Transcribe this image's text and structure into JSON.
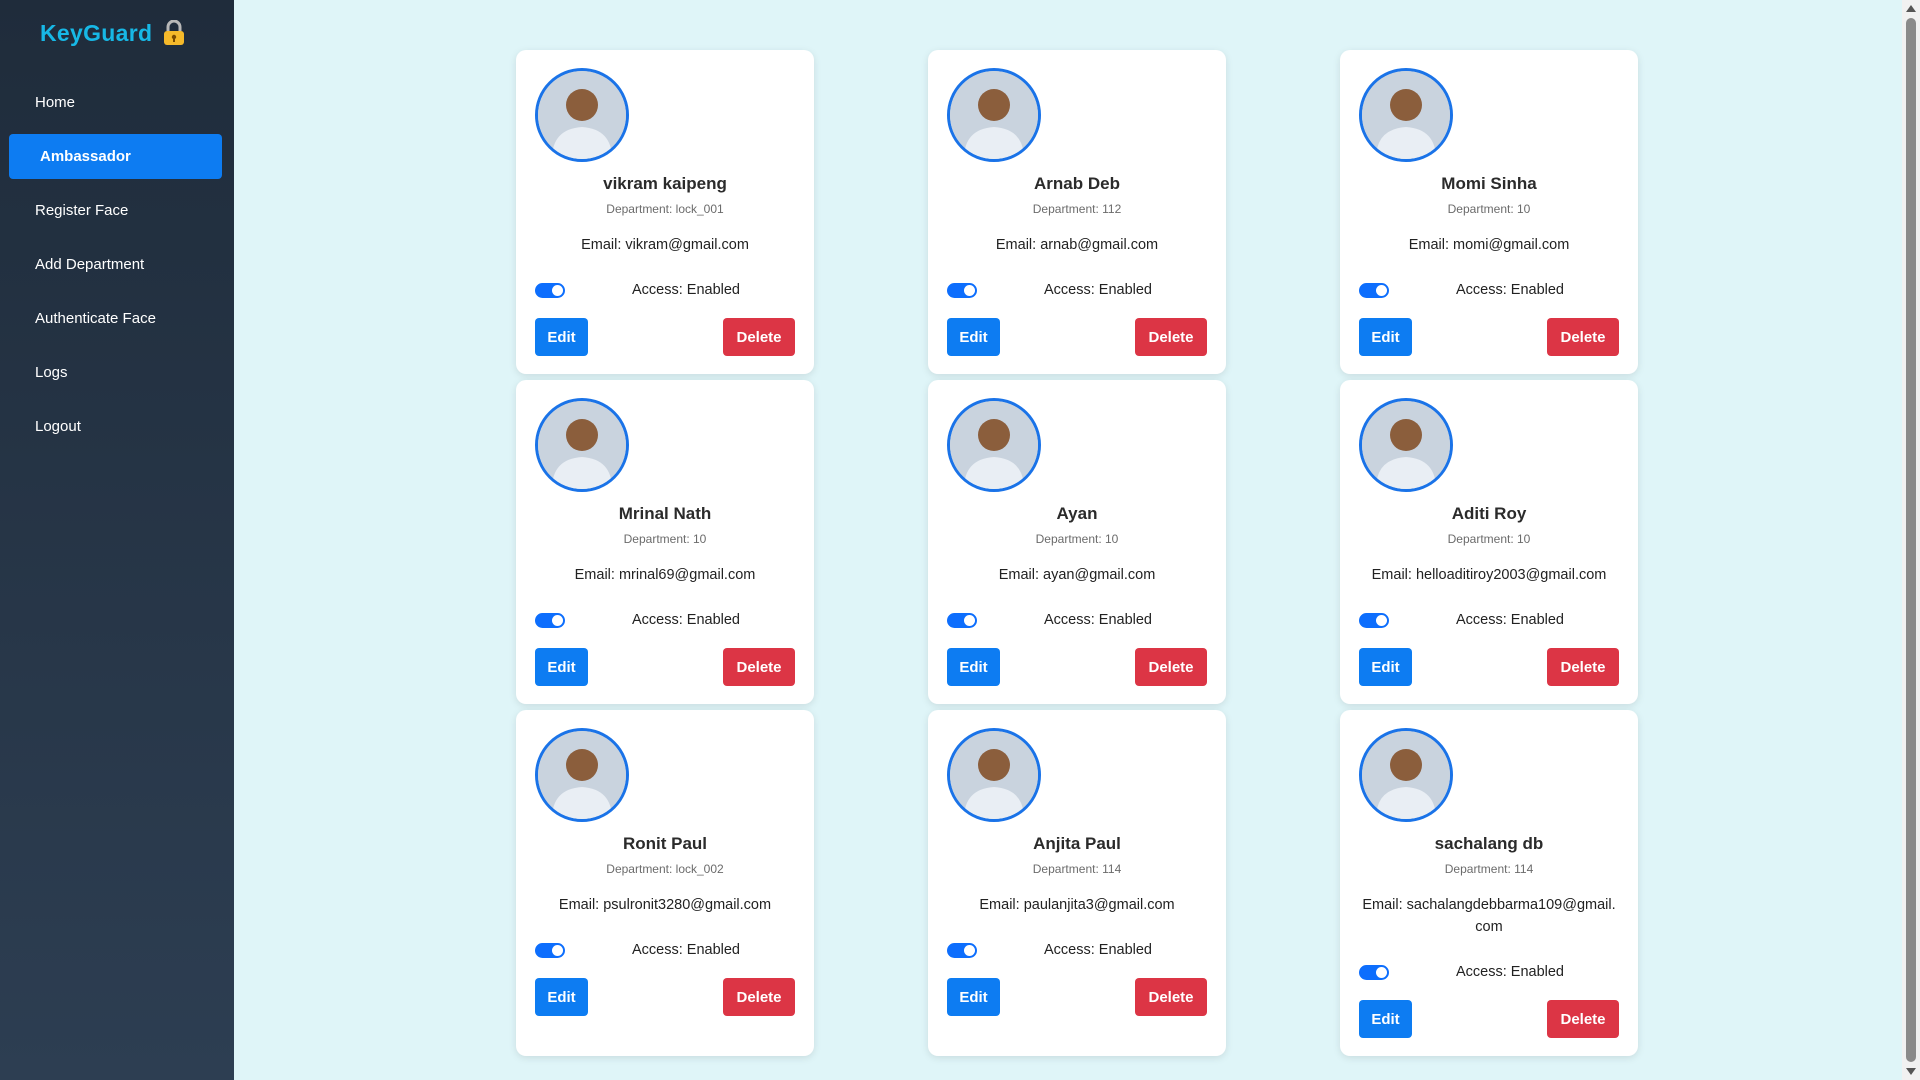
{
  "app": {
    "title": "KeyGuard",
    "brand_icon": "lock-icon",
    "colors": {
      "brand": "#17b8e6",
      "sidebar_bg": "#26364a",
      "active_nav": "#0d7cf2",
      "edit_button": "#0d7cf2",
      "delete_button": "#dc3545",
      "toggle_on": "#0d6efd",
      "page_bg": "#dff5f8"
    }
  },
  "sidebar": {
    "items": [
      {
        "label": "Home",
        "active": false
      },
      {
        "label": "Ambassador",
        "active": true
      },
      {
        "label": "Register Face",
        "active": false
      },
      {
        "label": "Add Department",
        "active": false
      },
      {
        "label": "Authenticate Face",
        "active": false
      },
      {
        "label": "Logs",
        "active": false
      },
      {
        "label": "Logout",
        "active": false
      }
    ]
  },
  "labels": {
    "edit": "Edit",
    "delete": "Delete"
  },
  "cards": [
    {
      "name": "vikram kaipeng",
      "department": "Department: lock_001",
      "email": "Email: vikram@gmail.com",
      "access": "Access: Enabled",
      "enabled": true
    },
    {
      "name": "Arnab Deb",
      "department": "Department: 112",
      "email": "Email: arnab@gmail.com",
      "access": "Access: Enabled",
      "enabled": true
    },
    {
      "name": "Momi Sinha",
      "department": "Department: 10",
      "email": "Email: momi@gmail.com",
      "access": "Access: Enabled",
      "enabled": true
    },
    {
      "name": "Mrinal Nath",
      "department": "Department: 10",
      "email": "Email: mrinal69@gmail.com",
      "access": "Access: Enabled",
      "enabled": true
    },
    {
      "name": "Ayan",
      "department": "Department: 10",
      "email": "Email: ayan@gmail.com",
      "access": "Access: Enabled",
      "enabled": true
    },
    {
      "name": "Aditi Roy",
      "department": "Department: 10",
      "email": "Email: helloaditiroy2003@gmail.com",
      "access": "Access: Enabled",
      "enabled": true
    },
    {
      "name": "Ronit Paul",
      "department": "Department: lock_002",
      "email": "Email: psulronit3280@gmail.com",
      "access": "Access: Enabled",
      "enabled": true
    },
    {
      "name": "Anjita Paul",
      "department": "Department: 114",
      "email": "Email: paulanjita3@gmail.com",
      "access": "Access: Enabled",
      "enabled": true
    },
    {
      "name": "sachalang db",
      "department": "Department: 114",
      "email": "Email: sachalangdebbarma109@gmail.com",
      "access": "Access: Enabled",
      "enabled": true
    }
  ]
}
